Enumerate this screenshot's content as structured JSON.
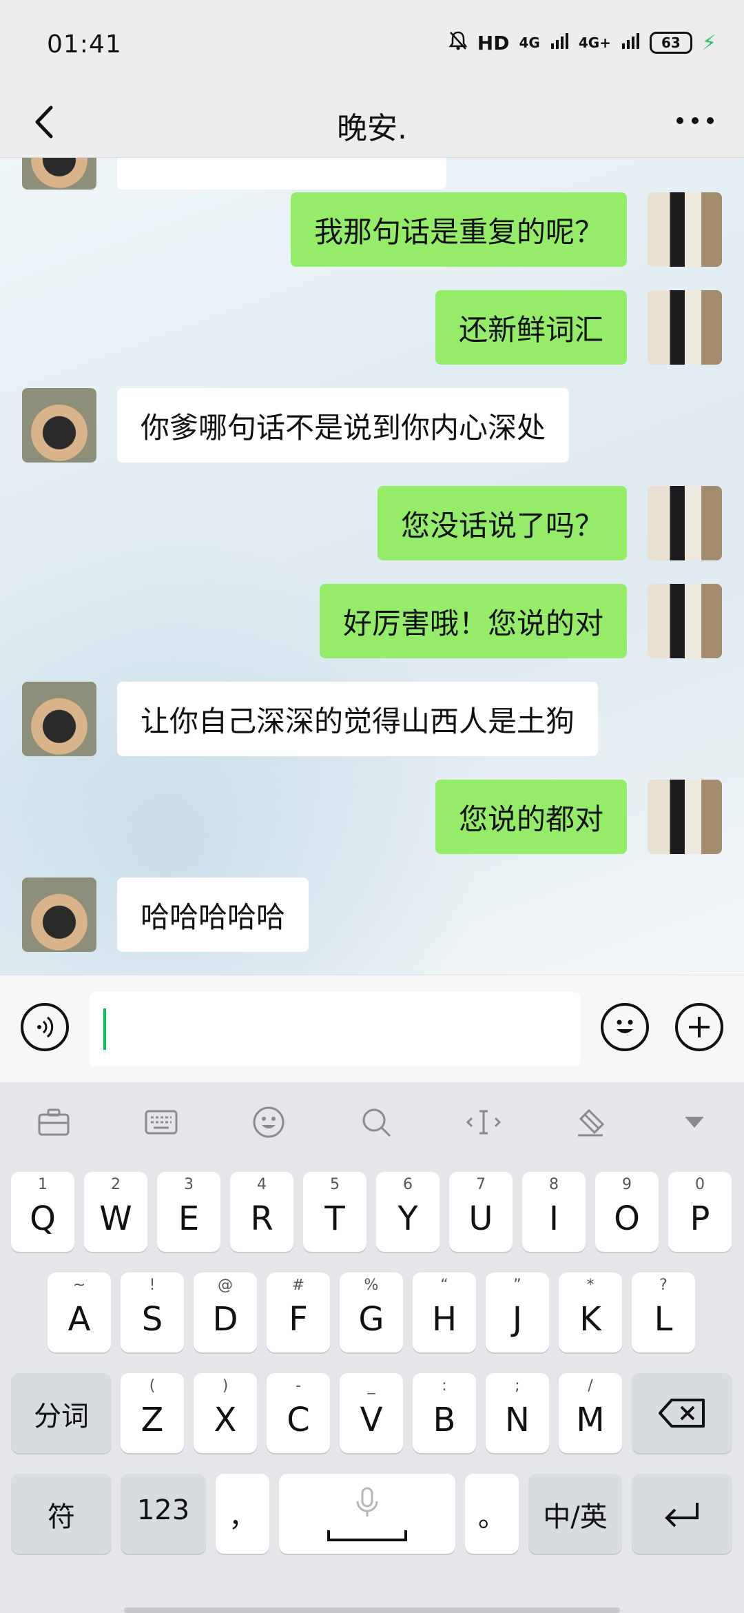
{
  "status": {
    "time": "01:41",
    "indicators": [
      "mute-bell-icon",
      "HD",
      "4G",
      "4G+"
    ],
    "net1": "4G",
    "net2": "4G+",
    "hd": "HD",
    "battery": "63"
  },
  "header": {
    "title": "晚安."
  },
  "messages": [
    {
      "side": "me",
      "text": "我那句话是重复的呢？"
    },
    {
      "side": "me",
      "text": "还新鲜词汇"
    },
    {
      "side": "them",
      "text": "你爹哪句话不是说到你内心深处"
    },
    {
      "side": "me",
      "text": "您没话说了吗？"
    },
    {
      "side": "me",
      "text": "好厉害哦！您说的对"
    },
    {
      "side": "them",
      "text": "让你自己深深的觉得山西人是土狗"
    },
    {
      "side": "me",
      "text": "您说的都对"
    },
    {
      "side": "them",
      "text": "哈哈哈哈哈"
    }
  ],
  "input": {
    "value": ""
  },
  "keyboard": {
    "toolbar": [
      "briefcase-icon",
      "keyboard-icon",
      "emoji-icon",
      "search-icon",
      "cursor-move-icon",
      "clear-icon",
      "collapse-icon"
    ],
    "row1": [
      {
        "sub": "1",
        "main": "Q"
      },
      {
        "sub": "2",
        "main": "W"
      },
      {
        "sub": "3",
        "main": "E"
      },
      {
        "sub": "4",
        "main": "R"
      },
      {
        "sub": "5",
        "main": "T"
      },
      {
        "sub": "6",
        "main": "Y"
      },
      {
        "sub": "7",
        "main": "U"
      },
      {
        "sub": "8",
        "main": "I"
      },
      {
        "sub": "9",
        "main": "O"
      },
      {
        "sub": "0",
        "main": "P"
      }
    ],
    "row2": [
      {
        "sub": "~",
        "main": "A"
      },
      {
        "sub": "!",
        "main": "S"
      },
      {
        "sub": "@",
        "main": "D"
      },
      {
        "sub": "#",
        "main": "F"
      },
      {
        "sub": "%",
        "main": "G"
      },
      {
        "sub": "“",
        "main": "H"
      },
      {
        "sub": "”",
        "main": "J"
      },
      {
        "sub": "*",
        "main": "K"
      },
      {
        "sub": "?",
        "main": "L"
      }
    ],
    "row3": [
      {
        "sub": "(",
        "main": "Z"
      },
      {
        "sub": ")",
        "main": "X"
      },
      {
        "sub": "-",
        "main": "C"
      },
      {
        "sub": "_",
        "main": "V"
      },
      {
        "sub": ":",
        "main": "B"
      },
      {
        "sub": ";",
        "main": "N"
      },
      {
        "sub": "/",
        "main": "M"
      }
    ],
    "segment_label": "分词",
    "symbol_label": "符",
    "number_label": "123",
    "comma": "，",
    "period": "。",
    "lang_label": "中/英"
  }
}
